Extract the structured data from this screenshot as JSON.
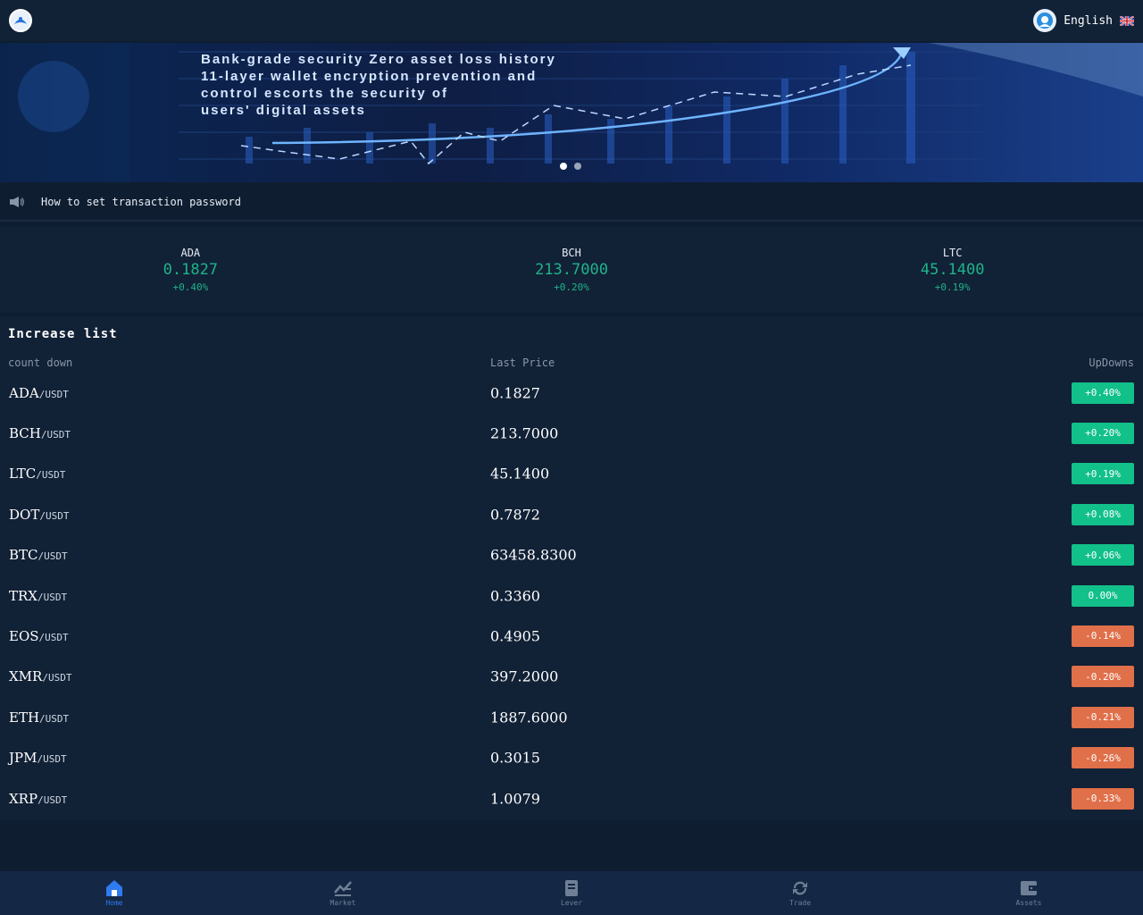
{
  "header": {
    "language": "English",
    "icons": {
      "logo": "brand-logo-icon",
      "avatar": "support-avatar-icon",
      "flag": "uk-flag-icon"
    }
  },
  "banner": {
    "lines": [
      "Bank-grade security Zero asset loss history",
      "11-layer wallet encryption prevention and",
      "control escorts the security of",
      "users' digital assets"
    ],
    "slides": 2,
    "active_slide": 0
  },
  "notice": {
    "text": "How to set transaction password",
    "icon": "megaphone-icon"
  },
  "tickers": [
    {
      "symbol": "ADA",
      "price": "0.1827",
      "change": "+0.40%"
    },
    {
      "symbol": "BCH",
      "price": "213.7000",
      "change": "+0.20%"
    },
    {
      "symbol": "LTC",
      "price": "45.1400",
      "change": "+0.19%"
    }
  ],
  "list": {
    "title": "Increase list",
    "columns": {
      "name": "count down",
      "price": "Last Price",
      "change": "UpDowns"
    },
    "quote": "/USDT",
    "rows": [
      {
        "symbol": "ADA",
        "price": "0.1827",
        "change": "+0.40%",
        "dir": "up"
      },
      {
        "symbol": "BCH",
        "price": "213.7000",
        "change": "+0.20%",
        "dir": "up"
      },
      {
        "symbol": "LTC",
        "price": "45.1400",
        "change": "+0.19%",
        "dir": "up"
      },
      {
        "symbol": "DOT",
        "price": "0.7872",
        "change": "+0.08%",
        "dir": "up"
      },
      {
        "symbol": "BTC",
        "price": "63458.8300",
        "change": "+0.06%",
        "dir": "up"
      },
      {
        "symbol": "TRX",
        "price": "0.3360",
        "change": "0.00%",
        "dir": "up"
      },
      {
        "symbol": "EOS",
        "price": "0.4905",
        "change": "-0.14%",
        "dir": "down"
      },
      {
        "symbol": "XMR",
        "price": "397.2000",
        "change": "-0.20%",
        "dir": "down"
      },
      {
        "symbol": "ETH",
        "price": "1887.6000",
        "change": "-0.21%",
        "dir": "down"
      },
      {
        "symbol": "JPM",
        "price": "0.3015",
        "change": "-0.26%",
        "dir": "down"
      },
      {
        "symbol": "XRP",
        "price": "1.0079",
        "change": "-0.33%",
        "dir": "down"
      }
    ]
  },
  "colors": {
    "up": "#12c08a",
    "down": "#e0704a",
    "accent": "#2f7bf0"
  },
  "tabbar": [
    {
      "label": "Home",
      "icon": "home-icon",
      "active": true
    },
    {
      "label": "Market",
      "icon": "market-icon",
      "active": false
    },
    {
      "label": "Lever",
      "icon": "lever-icon",
      "active": false
    },
    {
      "label": "Trade",
      "icon": "trade-icon",
      "active": false
    },
    {
      "label": "Assets",
      "icon": "assets-icon",
      "active": false
    }
  ]
}
